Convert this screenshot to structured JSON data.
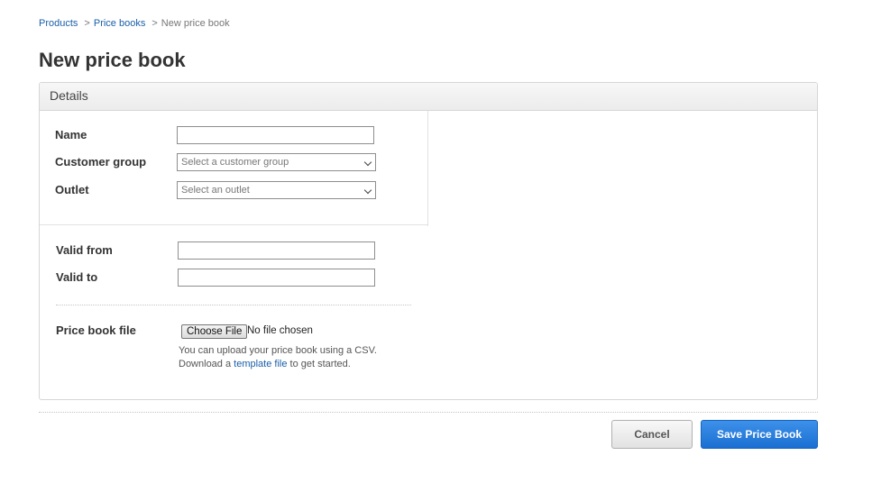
{
  "breadcrumb": {
    "items": [
      "Products",
      "Price books"
    ],
    "separator": ">",
    "current": "New price book"
  },
  "page": {
    "title": "New price book"
  },
  "panel": {
    "title": "Details"
  },
  "form": {
    "name": {
      "label": "Name",
      "value": ""
    },
    "customer_group": {
      "label": "Customer group",
      "placeholder": "Select a customer group"
    },
    "outlet": {
      "label": "Outlet",
      "placeholder": "Select an outlet"
    },
    "valid_from": {
      "label": "Valid from",
      "value": ""
    },
    "valid_to": {
      "label": "Valid to",
      "value": ""
    },
    "price_book_file": {
      "label": "Price book file",
      "choose_button": "Choose File",
      "status": "No file chosen",
      "help_line1": "You can upload your price book using a CSV.",
      "help_line2_prefix": "Download a ",
      "help_link": "template file",
      "help_line2_suffix": " to get started."
    }
  },
  "actions": {
    "cancel_label": "Cancel",
    "save_label": "Save Price Book"
  },
  "colors": {
    "link": "#1a5fa8",
    "primary": "#1b6fd1"
  },
  "icons": {
    "select_arrow": "chevron-down-icon"
  }
}
